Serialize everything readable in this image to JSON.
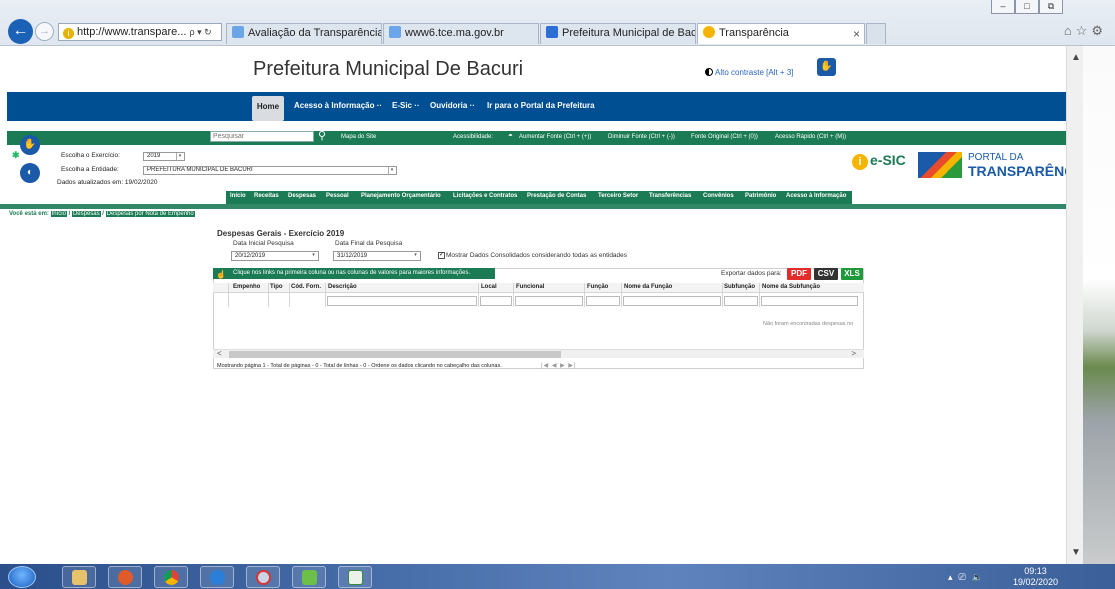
{
  "browser": {
    "address": "http://www.transpare...",
    "address_controls": "ρ ▾ ↻",
    "tabs": [
      {
        "label": "Avaliação da Transparência do..."
      },
      {
        "label": "www6.tce.ma.gov.br"
      },
      {
        "label": "Prefeitura Municipal de Bacuri"
      },
      {
        "label": "Transparência"
      }
    ],
    "close_glyph": "×",
    "toolbar_icons": "⌂☆⚙"
  },
  "header": {
    "site_title": "Prefeitura Municipal De Bacuri",
    "contrast_link": "Alto contraste [Alt + 3]"
  },
  "nav": {
    "items": [
      "Home",
      "Acesso à Informação ··",
      "E-Sic ··",
      "Ouvidoria ··",
      "Ir para o Portal da Prefeitura"
    ]
  },
  "accessibility_bar": {
    "search_placeholder": "Pesquisar",
    "site_map": "Mapa do Site",
    "accessibility_label": "Acessibilidade:",
    "increase_font": "Aumentar Fonte (Ctrl + (+))",
    "decrease_font": "Diminuir Fonte (Ctrl + (-))",
    "original_font": "Fonte Original (Ctrl + (0))",
    "quick_access": "Acesso Rápido (Ctrl + (M))"
  },
  "filters": {
    "exercise_label": "Escolha o Exercício:",
    "exercise_value": "2019",
    "entity_label": "Escolha a Entidade:",
    "entity_value": "PREFEITURA MUNICIPAL DE BACURI",
    "updated_text": "Dados atualizados em: 19/02/2020"
  },
  "logos": {
    "esic": "e-SIC",
    "portal_line1": "PORTAL DA",
    "portal_line2": "TRANSPARÊNCIA"
  },
  "subnav": {
    "items": [
      "Início",
      "Receitas",
      "Despesas",
      "Pessoal",
      "Planejamento Orçamentário",
      "Licitações e Contratos",
      "Prestação de Contas",
      "Terceiro Setor",
      "Transferências",
      "Convênios",
      "Patrimônio",
      "Acesso à Informação"
    ]
  },
  "breadcrumb": {
    "prefix": "Você está em:",
    "items": [
      "Início",
      "Despesas",
      "Despesas por Nota de Empenho"
    ]
  },
  "content": {
    "title": "Despesas Gerais - Exercício 2019",
    "start_label": "Data Inicial Pesquisa",
    "start_value": "20/12/2019",
    "end_label": "Data Final da Pesquisa",
    "end_value": "31/12/2019",
    "consolidated_label": "Mostrar Dados Consolidados considerando todas as entidades",
    "info_text": "Clique nos links na primeira coluna ou nas colunas de valores para maiores informações.",
    "export_label": "Exportar dados para:",
    "export_buttons": [
      "PDF",
      "CSV",
      "XLS"
    ],
    "columns": [
      "Empenho",
      "Tipo",
      "Cód. Forn.",
      "Descrição",
      "Local",
      "Funcional",
      "Função",
      "Nome da Função",
      "Subfunção",
      "Nome da Subfunção"
    ],
    "no_results": "Não foram encontradas despesas no",
    "status_text": "Mostrando página 1 - Total de páginas - 0 - Total de linhas - 0 - Ordene os dados clicando no cabeçalho das colunas.",
    "pager": "|◀ ◀ ▶ ▶|"
  },
  "taskbar": {
    "time": "09:13",
    "date": "19/02/2020"
  },
  "colors": {
    "nav_blue": "#004f93",
    "site_green": "#1b7b55",
    "pdf_red": "#e32b2b",
    "csv_dark": "#333333",
    "xls_green": "#1f9a3b"
  }
}
